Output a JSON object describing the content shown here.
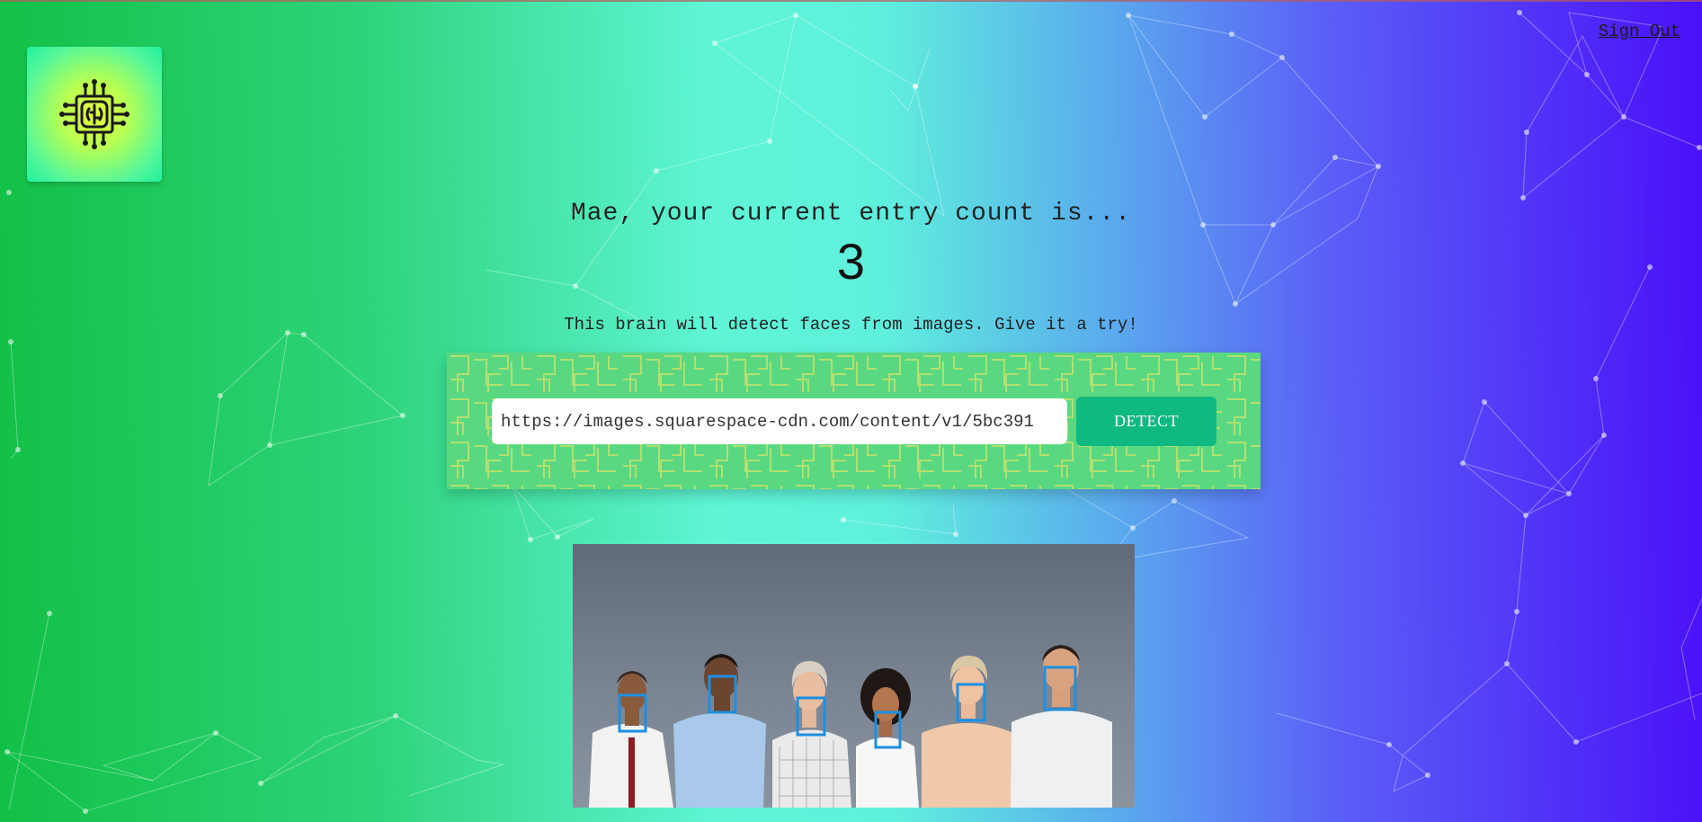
{
  "header": {
    "logo_icon": "brain-chip-icon",
    "signout_label": "Sign Out"
  },
  "main": {
    "greeting": "Mae, your current entry count is...",
    "entry_count": "3",
    "description": "This brain will detect faces from images. Give it a try!"
  },
  "form": {
    "url_value": "https://images.squarespace-cdn.com/content/v1/5bc391",
    "detect_label": "DETECT"
  },
  "image": {
    "subject": "group-of-six-people-photo",
    "face_box_count": 6,
    "face_box_color": "#1e8fe0"
  },
  "colors": {
    "gradient_left": "#12c046",
    "gradient_mid": "#5ff5d6",
    "gradient_right": "#4a10f8",
    "form_bg": "#5ad881",
    "button": "#10b981"
  }
}
